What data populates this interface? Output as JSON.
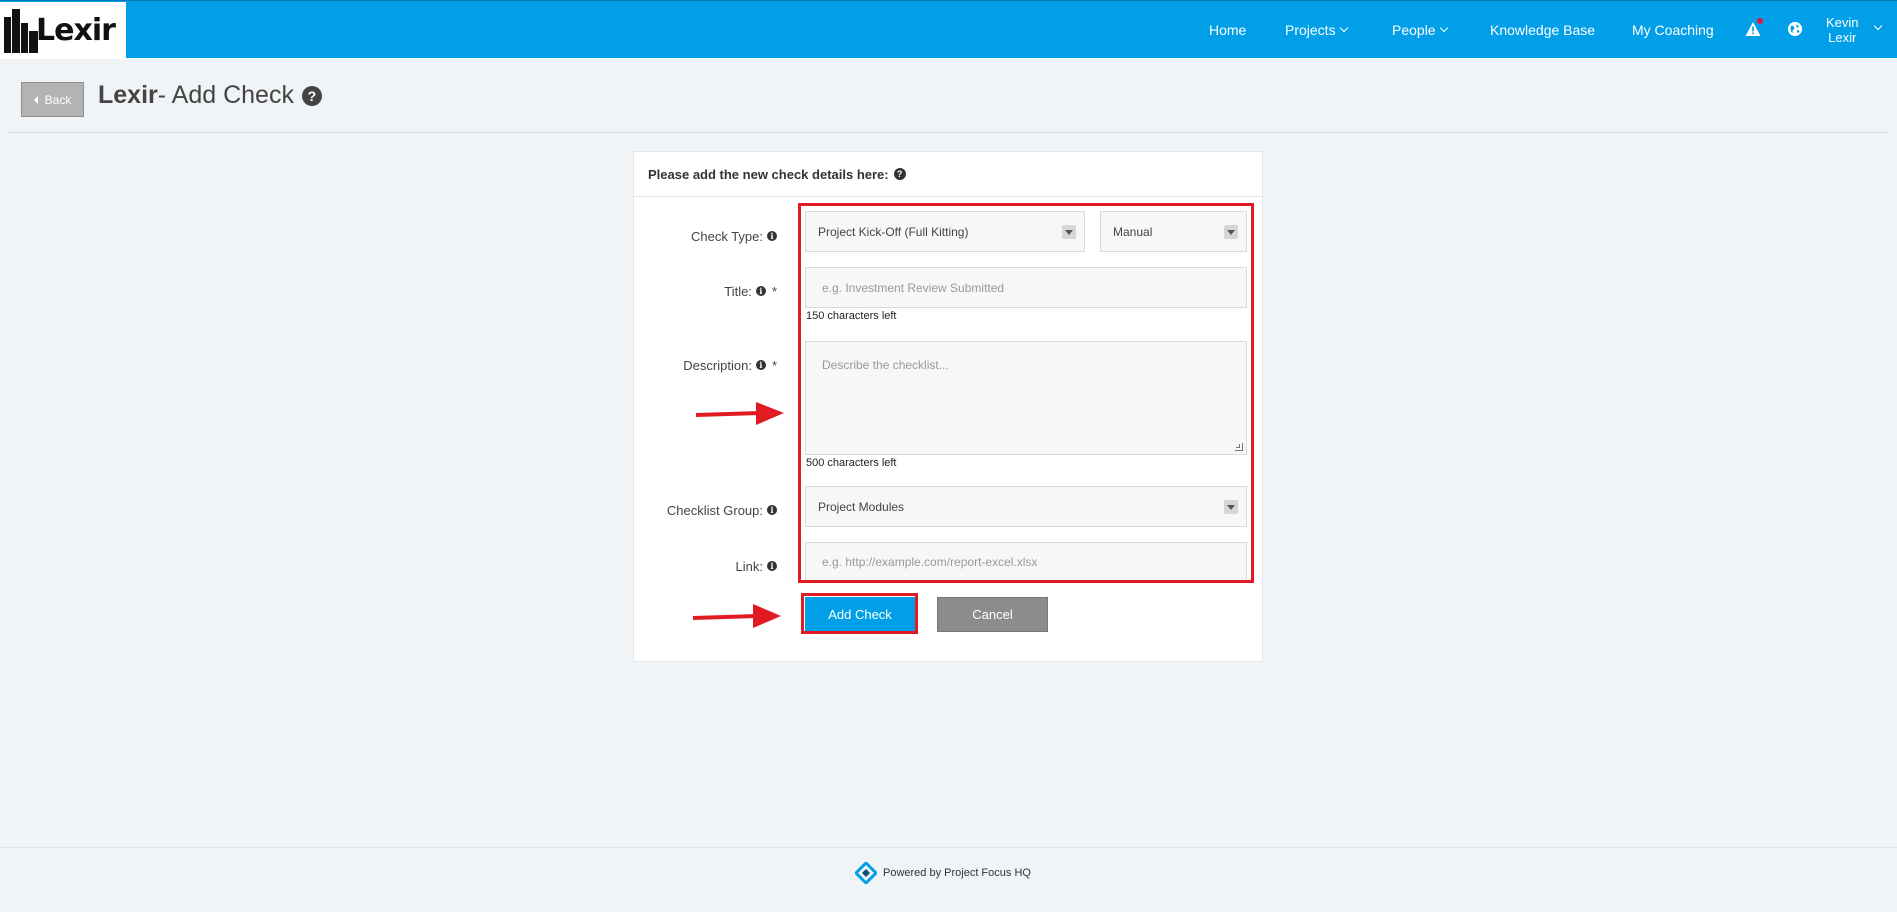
{
  "brand": {
    "name": "Lexir"
  },
  "nav": {
    "items": [
      {
        "label": "Home",
        "has_caret": false
      },
      {
        "label": "Projects",
        "has_caret": true
      },
      {
        "label": "People",
        "has_caret": true
      },
      {
        "label": "Knowledge Base",
        "has_caret": false
      },
      {
        "label": "My Coaching",
        "has_caret": false
      }
    ],
    "user_first": "Kevin",
    "user_last": "Lexir"
  },
  "header": {
    "back_label": "Back",
    "title_bold": "Lexir",
    "title_rest": "- Add Check"
  },
  "form": {
    "heading": "Please add the new check details here:",
    "check_type_label": "Check Type:",
    "check_type_value": "Project Kick-Off (Full Kitting)",
    "check_mode_value": "Manual",
    "title_label": "Title:",
    "title_placeholder": "e.g. Investment Review Submitted",
    "title_counter": "150 characters left",
    "description_label": "Description:",
    "description_placeholder": "Describe the checklist...",
    "description_counter": "500 characters left",
    "group_label": "Checklist Group:",
    "group_value": "Project Modules",
    "link_label": "Link:",
    "link_placeholder": "e.g. http://example.com/report-excel.xlsx",
    "required_mark": "*",
    "add_button": "Add Check",
    "cancel_button": "Cancel"
  },
  "footer": {
    "text": "Powered by Project Focus HQ"
  },
  "colors": {
    "nav": "#009fe8",
    "accent": "#009fe8",
    "annotation": "#e01b24",
    "cancel": "#8c8c8c"
  }
}
